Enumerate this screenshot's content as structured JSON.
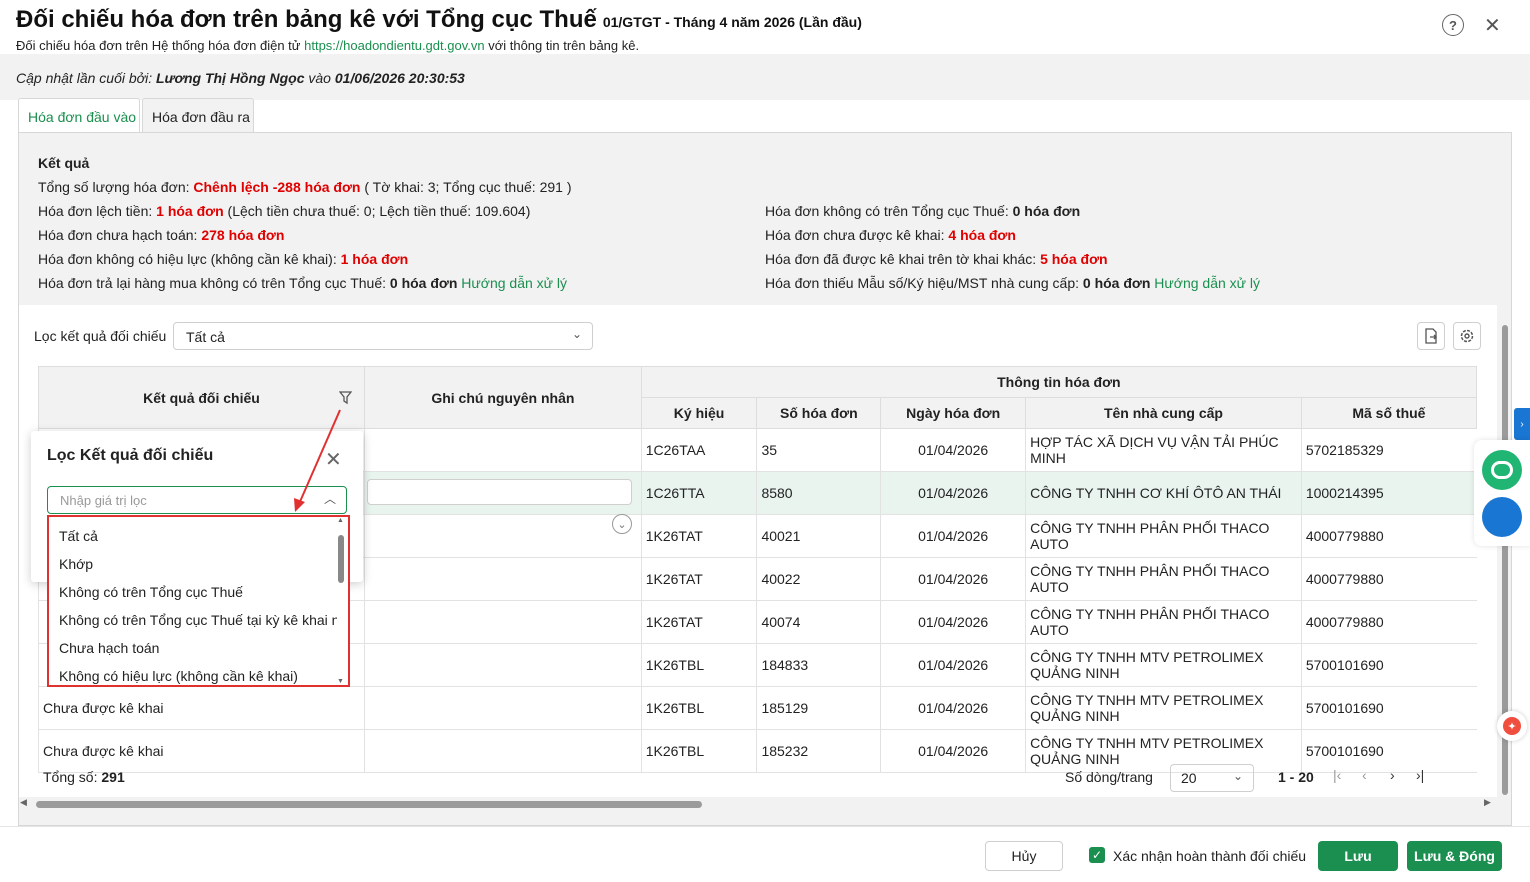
{
  "header": {
    "title": "Đối chiếu hóa đơn trên bảng kê với Tổng cục Thuế",
    "subtitle": "01/GTGT - Tháng 4 năm 2026 (Lần đầu)",
    "desc_prefix": "Đối chiếu hóa đơn trên Hệ thống hóa đơn điện tử",
    "desc_link": "https://hoadondientu.gdt.gov.vn",
    "desc_suffix": "với thông tin trên bảng kê.",
    "help_icon": "?",
    "close_icon": "✕"
  },
  "update": {
    "prefix": "Cập nhật lần cuối bởi:",
    "user": "Lương Thị Hồng Ngọc",
    "mid": "vào",
    "time": "01/06/2026 20:30:53"
  },
  "tabs": [
    "Hóa đơn đầu vào",
    "Hóa đơn đầu ra"
  ],
  "results": {
    "title": "Kết quả",
    "total_label": "Tổng số lượng hóa đơn:",
    "total_value": "Chênh lệch -288 hóa đơn",
    "total_detail": "( Tờ khai: 3; Tổng cục thuế: 291 )",
    "left": [
      {
        "label": "Hóa đơn lệch tiền:",
        "value": "1 hóa đơn",
        "detail": "(Lệch tiền chưa thuế: 0; Lệch tiền thuế: 109.604)"
      },
      {
        "label": "Hóa đơn chưa hạch toán:",
        "value": "278 hóa đơn",
        "detail": ""
      },
      {
        "label": "Hóa đơn không có hiệu lực (không cần kê khai):",
        "value": "1 hóa đơn",
        "detail": ""
      },
      {
        "label": "Hóa đơn trả lại hàng mua không có trên Tổng cục Thuế:",
        "value": "0 hóa đơn",
        "link": "Hướng dẫn xử lý"
      }
    ],
    "right": [
      {
        "label": "Hóa đơn không có trên Tổng cục Thuế:",
        "value": "0 hóa đơn"
      },
      {
        "label": "Hóa đơn chưa được kê khai:",
        "value": "4 hóa đơn"
      },
      {
        "label": "Hóa đơn đã được kê khai trên tờ khai khác:",
        "value": "5 hóa đơn"
      },
      {
        "label": "Hóa đơn thiếu Mẫu số/Ký hiệu/MST nhà cung cấp:",
        "value": "0 hóa đơn",
        "link": "Hướng dẫn xử lý"
      }
    ]
  },
  "filter": {
    "label": "Lọc kết quả đối chiếu",
    "selected": "Tất cả",
    "chevron": "⌄"
  },
  "table": {
    "col_result": "Kết quả đối chiếu",
    "col_note": "Ghi chú nguyên nhân",
    "group": "Thông tin hóa đơn",
    "cols": [
      "Ký hiệu",
      "Số hóa đơn",
      "Ngày hóa đơn",
      "Tên nhà cung cấp",
      "Mã số thuế"
    ],
    "rows": [
      {
        "result": "",
        "note": "",
        "kh": "1C26TAA",
        "so": "35",
        "ngay": "01/04/2026",
        "ten": "HỢP TÁC XÃ DỊCH VỤ VẬN TẢI PHÚC MINH",
        "mst": "5702185329"
      },
      {
        "result": "",
        "note": "",
        "kh": "1C26TTA",
        "so": "8580",
        "ngay": "01/04/2026",
        "ten": "CÔNG TY TNHH CƠ KHÍ ÔTÔ AN THÁI",
        "mst": "1000214395"
      },
      {
        "result": "",
        "note": "",
        "kh": "1K26TAT",
        "so": "40021",
        "ngay": "01/04/2026",
        "ten": "CÔNG TY TNHH PHÂN PHỐI THACO AUTO",
        "mst": "4000779880"
      },
      {
        "result": "",
        "note": "",
        "kh": "1K26TAT",
        "so": "40022",
        "ngay": "01/04/2026",
        "ten": "CÔNG TY TNHH PHÂN PHỐI THACO AUTO",
        "mst": "4000779880"
      },
      {
        "result": "",
        "note": "",
        "kh": "1K26TAT",
        "so": "40074",
        "ngay": "01/04/2026",
        "ten": "CÔNG TY TNHH PHÂN PHỐI THACO AUTO",
        "mst": "4000779880"
      },
      {
        "result": "",
        "note": "",
        "kh": "1K26TBL",
        "so": "184833",
        "ngay": "01/04/2026",
        "ten": "CÔNG TY TNHH MTV PETROLIMEX QUẢNG NINH",
        "mst": "5700101690"
      },
      {
        "result": "Chưa được kê khai",
        "note": "",
        "kh": "1K26TBL",
        "so": "185129",
        "ngay": "01/04/2026",
        "ten": "CÔNG TY TNHH MTV PETROLIMEX QUẢNG NINH",
        "mst": "5700101690"
      },
      {
        "result": "Chưa được kê khai",
        "note": "",
        "kh": "1K26TBL",
        "so": "185232",
        "ngay": "01/04/2026",
        "ten": "CÔNG TY TNHH MTV PETROLIMEX QUẢNG NINH",
        "mst": "5700101690"
      }
    ]
  },
  "footer": {
    "total_label": "Tổng số:",
    "total_value": "291",
    "rows_label": "Số dòng/trang",
    "rows_value": "20",
    "range": "1 - 20"
  },
  "popup": {
    "title": "Lọc Kết quả đối chiếu",
    "placeholder": "Nhập giá trị lọc",
    "options": [
      "Tất cả",
      "Khớp",
      "Không có trên Tổng cục Thuế",
      "Không có trên Tổng cục Thuế tại kỳ kê khai n",
      "Chưa hạch toán",
      "Không có hiệu lực (không cần kê khai)"
    ]
  },
  "bottom": {
    "cancel": "Hủy",
    "confirm": "Xác nhận hoàn thành đối chiếu",
    "save": "Lưu",
    "save_close": "Lưu & Đóng"
  },
  "colors": {
    "brand_green": "#1a8f4f",
    "alert_red": "#e00000",
    "side_blue": "#1976d2"
  }
}
